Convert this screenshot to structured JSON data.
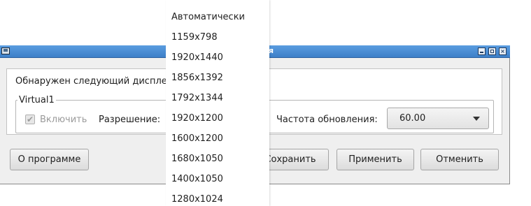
{
  "window": {
    "title_suffix": "ля"
  },
  "content": {
    "detected_label": "Обнаружен следующий диспле",
    "group_title": "Virtual1",
    "enable_label": "Включить",
    "enable_checked": true,
    "resolution_label": "Разрешение:",
    "refresh_label": "Частота обновления:",
    "refresh_value": "60.00"
  },
  "buttons": {
    "about": "О программе",
    "save": "Сохранить",
    "apply": "Применить",
    "cancel": "Отменить"
  },
  "resolution_options": [
    "Автоматически",
    "1159x798",
    "1920x1440",
    "1856x1392",
    "1792x1344",
    "1920x1200",
    "1600x1200",
    "1680x1050",
    "1400x1050",
    "1280x1024"
  ],
  "colors": {
    "titlebar": "#3d7fc8",
    "window_bg": "#efefef"
  }
}
